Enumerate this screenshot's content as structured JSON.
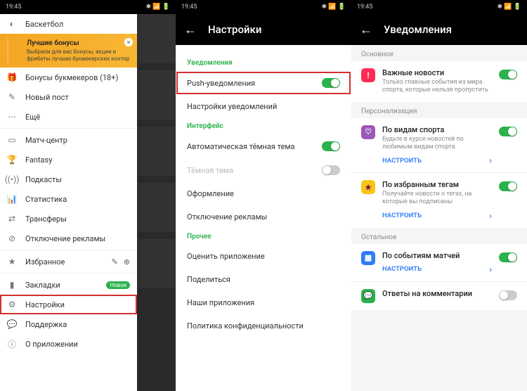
{
  "statusbar": {
    "time": "19:45"
  },
  "screen1": {
    "drawer": {
      "basketball": "Баскетбол",
      "bonus": {
        "title": "Лучшие бонусы",
        "subtitle": "Выбрали для вас бонусы, акции и фрибеты лучших букмекерских контор"
      },
      "items": {
        "bookmaker_bonuses": "Бонусы букмекеров (18+)",
        "new_post": "Новый пост",
        "more": "Ещё",
        "match_center": "Матч-центр",
        "fantasy": "Fantasy",
        "podcasts": "Подкасты",
        "stats": "Статистика",
        "transfers": "Трансферы",
        "ads_off": "Отключение рекламы",
        "favorites": "Избранное",
        "bookmarks": "Закладки",
        "bookmarks_badge": "Новое",
        "settings": "Настройки",
        "support": "Поддержка",
        "about": "О приложении"
      }
    }
  },
  "screen2": {
    "title": "Настройки",
    "sections": {
      "notifications": "Уведомления",
      "interface": "Интерфейс",
      "other": "Прочее"
    },
    "rows": {
      "push": "Push-уведомления",
      "notif_settings": "Настройки уведомлений",
      "auto_dark": "Автоматическая тёмная тема",
      "dark": "Тёмная тема",
      "design": "Оформление",
      "ads_off": "Отключение рекламы",
      "rate": "Оценить приложение",
      "share": "Поделиться",
      "our_apps": "Наши приложения",
      "privacy": "Политика конфиденциальности"
    }
  },
  "screen3": {
    "title": "Уведомления",
    "sections": {
      "main": "Основное",
      "personalization": "Персонализация",
      "other": "Остальное"
    },
    "cards": {
      "important": {
        "title": "Важные новости",
        "sub": "Только главные события из мира спорта, которые нельзя пропустить"
      },
      "by_sport": {
        "title": "По видам спорта",
        "sub": "Будьте в курсе новостей по любимым видам спорта",
        "link": "НАСТРОИТЬ"
      },
      "by_tags": {
        "title": "По избранным тегам",
        "sub": "Получайте новости о тегах, на которые вы подписаны",
        "link": "НАСТРОИТЬ"
      },
      "match_events": {
        "title": "По событиям матчей",
        "link": "НАСТРОИТЬ"
      },
      "comment_replies": {
        "title": "Ответы на комментарии"
      }
    }
  }
}
